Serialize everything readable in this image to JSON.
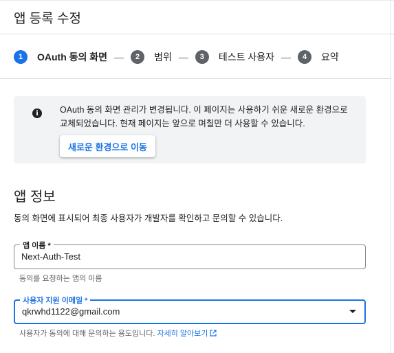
{
  "page": {
    "title": "앱 등록 수정"
  },
  "stepper": {
    "steps": [
      {
        "number": "1",
        "label": "OAuth 동의 화면",
        "active": true
      },
      {
        "number": "2",
        "label": "범위",
        "active": false
      },
      {
        "number": "3",
        "label": "테스트 사용자",
        "active": false
      },
      {
        "number": "4",
        "label": "요약",
        "active": false
      }
    ],
    "separator": "—"
  },
  "notice": {
    "icon": "info-icon",
    "text": "OAuth 동의 화면 관리가 변경됩니다. 이 페이지는 사용하기 쉬운 새로운 환경으로 교체되었습니다. 현재 페이지는 앞으로 며칠만 더 사용할 수 있습니다.",
    "button_label": "새로운 환경으로 이동"
  },
  "app_info": {
    "title": "앱 정보",
    "description": "동의 화면에 표시되어 최종 사용자가 개발자를 확인하고 문의할 수 있습니다.",
    "app_name": {
      "label": "앱 이름 *",
      "value": "Next-Auth-Test",
      "hint": "동의를 요청하는 앱의 이름"
    },
    "support_email": {
      "label": "사용자 지원 이메일 *",
      "value": "qkrwhd1122@gmail.com",
      "hint": "사용자가 동의에 대해 문의하는 용도입니다.",
      "link_label": "자세히 알아보기"
    }
  },
  "colors": {
    "accent": "#1a73e8",
    "step_inactive": "#5f6368",
    "notice_bg": "#f1f3f4"
  }
}
